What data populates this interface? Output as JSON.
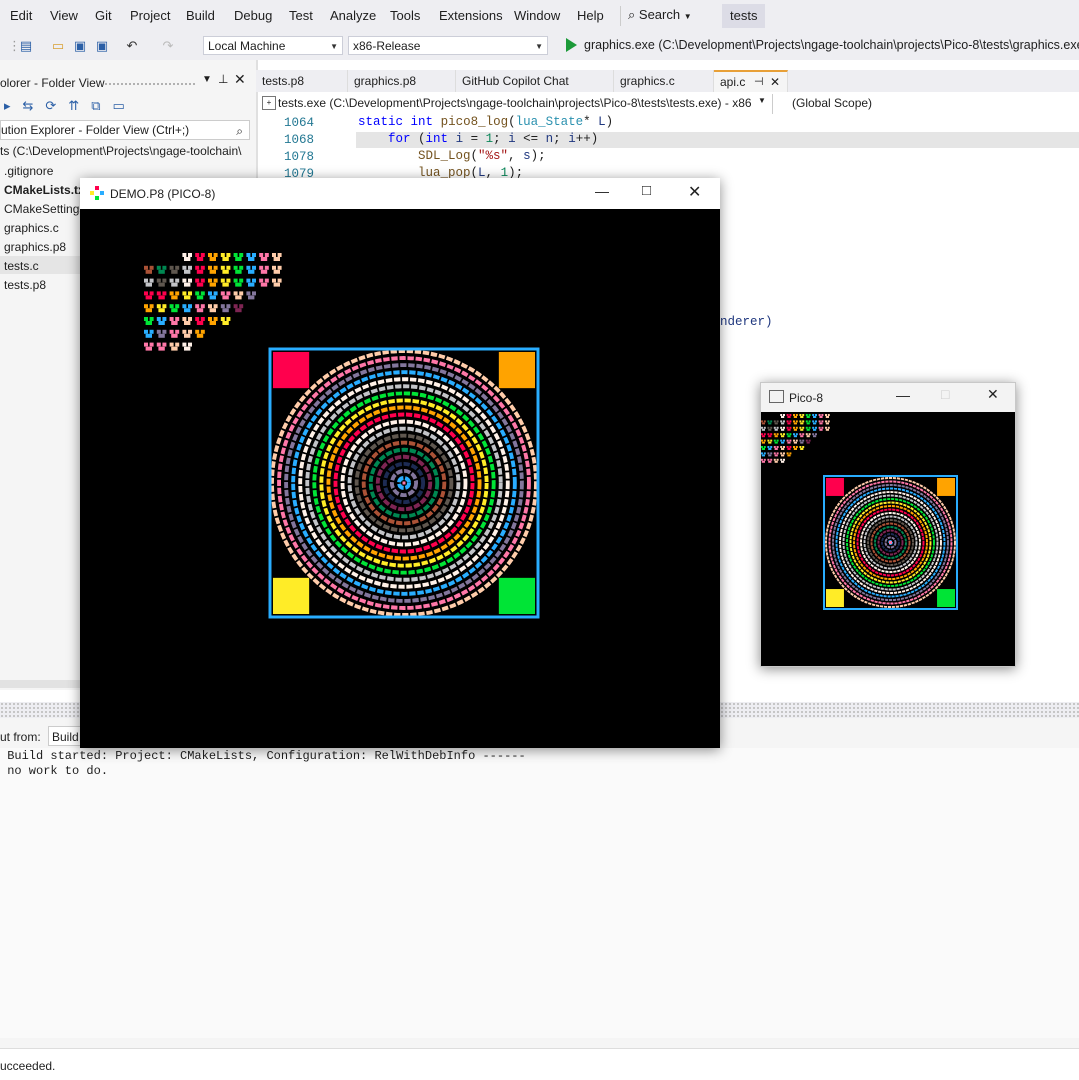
{
  "menu": [
    "Edit",
    "View",
    "Git",
    "Project",
    "Build",
    "Debug",
    "Test",
    "Analyze",
    "Tools",
    "Extensions",
    "Window",
    "Help"
  ],
  "search_label": "Search",
  "solution_name": "tests",
  "toolbar": {
    "target_combo": "Local Machine",
    "config_combo": "x86-Release",
    "run_label": "graphics.exe (C:\\Development\\Projects\\ngage-toolchain\\projects\\Pico-8\\tests\\graphics.exe)"
  },
  "solution_explorer": {
    "title": "olorer - Folder View",
    "search_placeholder": "ution Explorer - Folder View (Ctrl+;)",
    "root": "ts (C:\\Development\\Projects\\ngage-toolchain\\",
    "items": [
      ".gitignore",
      "CMakeLists.txt",
      "CMakeSettings.json",
      "graphics.c",
      "graphics.p8",
      "tests.c",
      "tests.p8"
    ],
    "selected": "tests.c"
  },
  "tabs": [
    "tests.p8",
    "graphics.p8",
    "GitHub Copilot Chat",
    "graphics.c",
    "api.c"
  ],
  "active_tab": "api.c",
  "navbar": {
    "project": "tests.exe (C:\\Development\\Projects\\ngage-toolchain\\projects\\Pico-8\\tests\\tests.exe) - x86",
    "scope": "(Global Scope)"
  },
  "code": {
    "line_numbers": [
      "1064",
      "1068",
      "1078",
      "1079"
    ],
    "partial_text": "nderer)"
  },
  "demo_window": {
    "title": "DEMO.P8 (PICO-8)"
  },
  "pico_window": {
    "title": "Pico-8"
  },
  "output": {
    "from_label": "ut from:",
    "from_value": "Build",
    "lines": [
      " Build started: Project: CMakeLists, Configuration: RelWithDebInfo ------",
      " no work to do."
    ]
  },
  "status": "ucceeded.",
  "colors": {
    "pico_palette": [
      "#000000",
      "#1d2b53",
      "#7e2553",
      "#008751",
      "#ab5236",
      "#5f574f",
      "#c2c3c7",
      "#fff1e8",
      "#ff004d",
      "#ffa300",
      "#ffec27",
      "#00e436",
      "#29adff",
      "#83769c",
      "#ff77a8",
      "#ffccaa"
    ],
    "accent_tab": "#e8a037",
    "run_green": "#1c9a39"
  }
}
